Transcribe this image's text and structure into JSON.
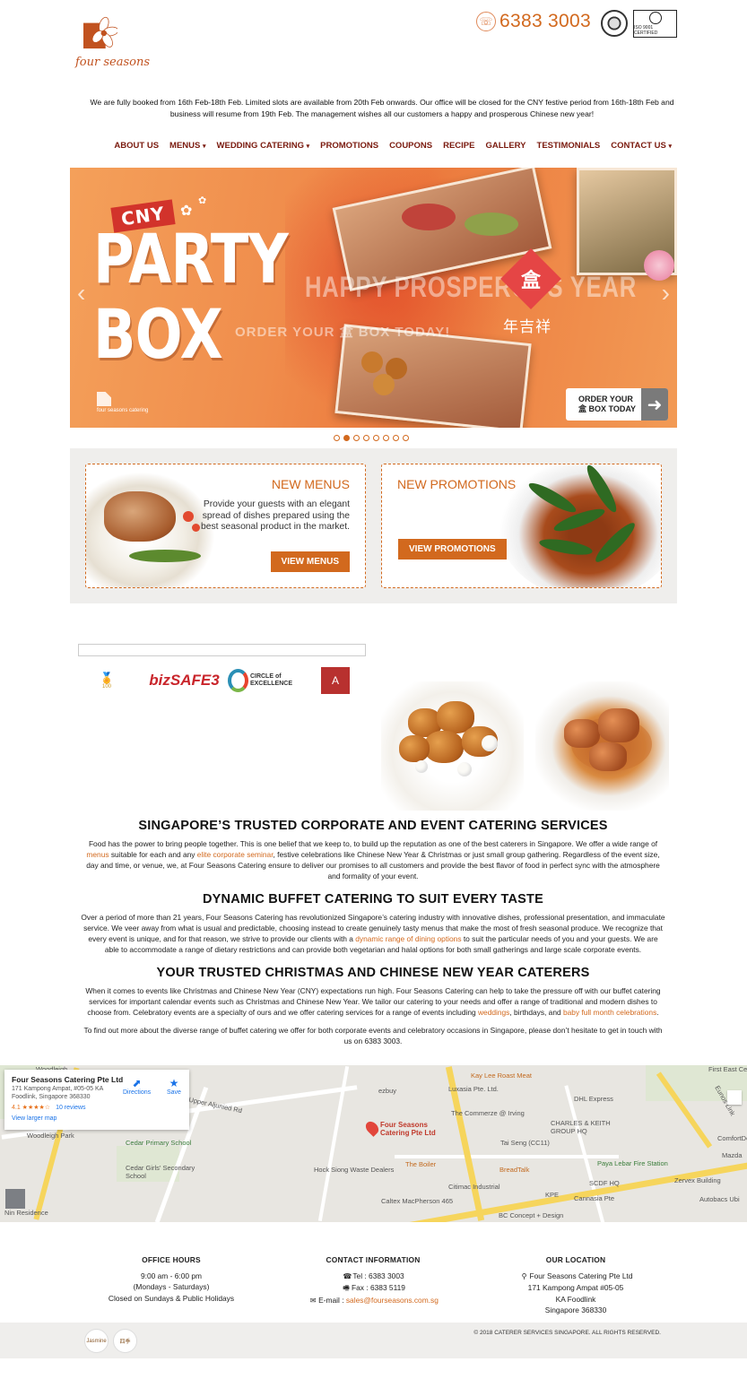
{
  "header": {
    "brand": "four seasons",
    "phone": "6383 3003",
    "cert_text": "ISO 9001 CERTIFIED"
  },
  "notice": "We are fully booked from 16th Feb-18th Feb. Limited slots are available from 20th Feb onwards. Our office will be closed for the CNY festive period from 16th-18th Feb and business will resume from 19th Feb. The management wishes all our customers a happy and prosperous Chinese new year!",
  "nav": {
    "items": [
      {
        "label": "ABOUT US",
        "caret": ""
      },
      {
        "label": "MENUS",
        "caret": "▾"
      },
      {
        "label": "WEDDING CATERING",
        "caret": "▾"
      },
      {
        "label": "PROMOTIONS",
        "caret": ""
      },
      {
        "label": "COUPONS",
        "caret": ""
      },
      {
        "label": "RECIPE",
        "caret": ""
      },
      {
        "label": "GALLERY",
        "caret": ""
      },
      {
        "label": "TESTIMONIALS",
        "caret": ""
      },
      {
        "label": "CONTACT US",
        "caret": "▾"
      }
    ]
  },
  "hero": {
    "tag": "CNY",
    "line1": "PARTY",
    "line2": "BOX",
    "ghost1": "HAPPY PROSPEROUS YEAR",
    "ghost2": "ORDER YOUR 盒 BOX TODAY!",
    "seal": "盒",
    "chinese": "年吉祥",
    "small_logo": "four seasons catering",
    "order_line1": "ORDER YOUR",
    "order_line2": "盒 BOX TODAY",
    "slides": 8,
    "active_slide": 2
  },
  "promos": {
    "menus": {
      "title": "NEW MENUS",
      "text": "Provide your guests with an elegant spread of dishes prepared using the best seasonal product in the market.",
      "button": "VIEW MENUS"
    },
    "promotions": {
      "title": "NEW PROMOTIONS",
      "button": "VIEW PROMOTIONS"
    }
  },
  "awards": {
    "a1": "100",
    "a2": "bizSAFE3",
    "a3_line1": "CIRCLE of",
    "a3_line2": "EXCELLENCE",
    "a4": "A"
  },
  "content": {
    "h1": "SINGAPORE’S TRUSTED CORPORATE AND EVENT CATERING SERVICES",
    "p1_a": "Food has the power to bring people together. This is one belief that we keep to, to build up the reputation as one of the best caterers in Singapore. We offer a wide range of ",
    "p1_link1": "menus",
    "p1_b": " suitable for each and any ",
    "p1_link2": "elite corporate seminar",
    "p1_c": ", festive celebrations like Chinese New Year & Christmas or just small group gathering. Regardless of the event size, day and time, or venue, we, at Four Seasons Catering ensure to deliver our promises to all customers and provide the best flavor of food in perfect sync with the atmosphere and formality of your event.",
    "h2": "DYNAMIC BUFFET CATERING TO SUIT EVERY TASTE",
    "p2_a": "Over a period of more than 21 years, Four Seasons Catering has revolutionized Singapore’s catering industry with innovative dishes, professional presentation, and immaculate service. We veer away from what is usual and predictable, choosing instead to create genuinely tasty menus that make the most of fresh seasonal produce. We recognize that every event is unique, and for that reason, we strive to provide our clients with a ",
    "p2_link": "dynamic range of dining options",
    "p2_b": " to suit the particular needs of you and your guests. We are able to accommodate a range of dietary restrictions and can provide both vegetarian and halal options for both small gatherings and large scale corporate events.",
    "h3": "YOUR TRUSTED CHRISTMAS AND CHINESE NEW YEAR CATERERS",
    "p3_a": "When it comes to events like Christmas and Chinese New Year (CNY) expectations run high. Four Seasons Catering can help to take the pressure off with our buffet catering services for important calendar events such as Christmas and Chinese New Year. We tailor our catering to your needs and offer a range of traditional and modern dishes to choose from. Celebratory events are a specialty of ours and we offer catering services for a range of events including ",
    "p3_link1": "weddings",
    "p3_b": ", birthdays, and ",
    "p3_link2": "baby full month celebrations",
    "p3_c": ".",
    "p4": "To find out more about the diverse range of buffet catering we offer for both corporate events and celebratory occasions in Singapore, please don’t hesitate to get in touch with us on 6383 3003."
  },
  "map": {
    "name": "Four Seasons Catering Pte Ltd",
    "address": "171 Kampong Ampat, #05-05 KA Foodlink, Singapore 368330",
    "rating": "4.1 ★★★★☆",
    "reviews": "10 reviews",
    "larger": "View larger map",
    "directions": "Directions",
    "save": "Save",
    "pin_label1": "Four Seasons",
    "pin_label2": "Catering Pte Ltd",
    "labels": {
      "l1": "Woodleigh",
      "l2": "Upper Aljunied Rd",
      "l3": "Cedar Primary School",
      "l4": "Cedar Girls' Secondary School",
      "l5": "Hock Siong Waste Dealers",
      "l6": "Kay Lee Roast Meat",
      "l7": "Luxasia Pte. Ltd.",
      "l8": "The Commerze @ Irving",
      "l9": "Tai Seng (CC11)",
      "l10": "The Boiler",
      "l11": "BreadTalk",
      "l12": "Citimac Industrial",
      "l13": "Caltex MacPherson 465",
      "l14": "DHL Express",
      "l15": "CHARLES & KEITH GROUP HQ",
      "l16": "Paya Lebar Fire Station",
      "l17": "SCDF HQ",
      "l18": "Cannasia Pte",
      "l19": "Zervex Building",
      "l20": "Eunos Link",
      "l21": "KPE",
      "l22": "BC Concept + Design",
      "l23": "Nin Residence",
      "l24": "Woodleigh Park",
      "l25": "ComfortDe",
      "l26": "Autobacs Ubi",
      "l27": "First East Ce",
      "l28": "Mazda",
      "l29": "ezbuy"
    }
  },
  "footer": {
    "hours": {
      "title": "OFFICE HOURS",
      "l1": "9:00 am - 6:00 pm",
      "l2": "(Mondays - Saturdays)",
      "l3": "Closed on Sundays & Public Holidays"
    },
    "contact": {
      "title": "CONTACT INFORMATION",
      "tel": "Tel : 6383 3003",
      "fax": "Fax : 6383 5119",
      "email_label": "E-mail : ",
      "email": "sales@fourseasons.com.sg"
    },
    "location": {
      "title": "OUR LOCATION",
      "l1": "Four Seasons Catering Pte Ltd",
      "l2": "171 Kampong Ampat #05-05",
      "l3": "KA Foodlink",
      "l4": "Singapore 368330"
    },
    "copyright": "© 2018 CATERER SERVICES SINGAPORE. ALL RIGHTS RESERVED.",
    "logo1": "Jasmine",
    "logo2": "四季"
  }
}
